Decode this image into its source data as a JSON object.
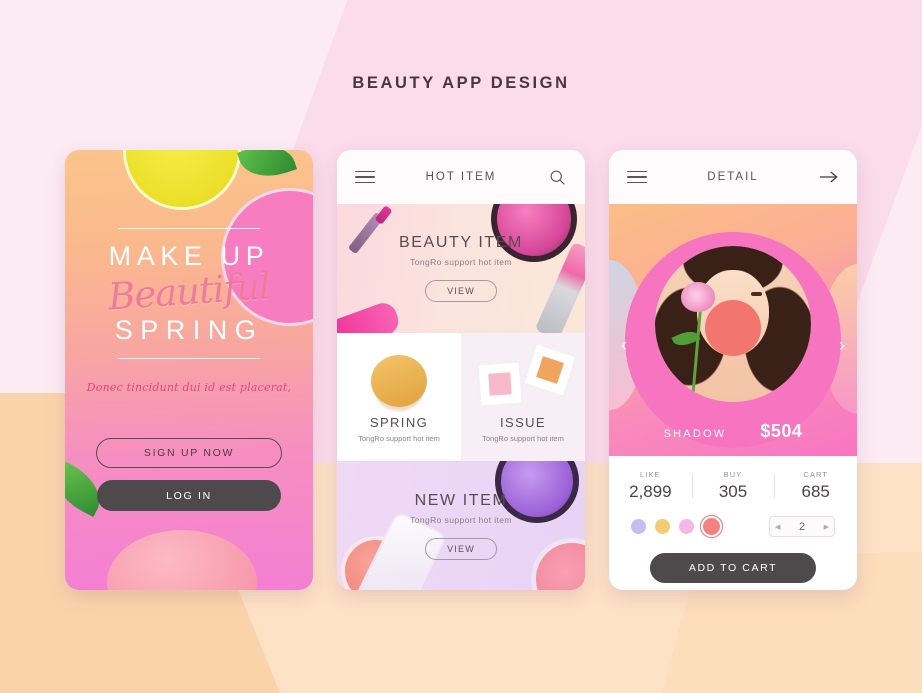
{
  "page": {
    "title": "BEAUTY APP DESIGN",
    "background_color": "#fcebf3",
    "accent_pink": "#f775c0",
    "accent_peach": "#fbbe86",
    "dark_button": "#4e4a4b"
  },
  "screen1": {
    "name": "intro-screen",
    "headline": "MAKE UP",
    "script_word": "Beautiful",
    "subheadline": "SPRING",
    "tagline": "Donec tincidunt dui id est placerat,",
    "signup_label": "SIGN UP NOW",
    "login_label": "LOG IN",
    "decor": [
      "lemon-half",
      "green-leaf",
      "pink-blush-compact",
      "powder-puff"
    ]
  },
  "screen2": {
    "name": "hot-item-screen",
    "header": {
      "menu_icon": "hamburger-menu-icon",
      "title": "HOT ITEM",
      "search_icon": "search-icon"
    },
    "sections": [
      {
        "title": "BEAUTY ITEM",
        "subtitle": "TongRo support hot item",
        "button": "VIEW",
        "background": "#fbdfdc"
      },
      {
        "title": "NEW ITEM",
        "subtitle": "TongRo support hot item",
        "button": "VIEW",
        "background": "#ead6f4"
      }
    ],
    "cards": [
      {
        "title": "SPRING",
        "subtitle": "TongRo support hot item",
        "background": "#ffffff"
      },
      {
        "title": "ISSUE",
        "subtitle": "TongRo support hot item",
        "background": "#f8eef6"
      }
    ]
  },
  "screen3": {
    "name": "detail-screen",
    "header": {
      "menu_icon": "hamburger-menu-icon",
      "title": "DETAIL",
      "forward_icon": "arrow-right-icon"
    },
    "carousel": {
      "prev_icon": "chevron-left-icon",
      "next_icon": "chevron-right-icon"
    },
    "product": {
      "name": "SHADOW",
      "price": "$504"
    },
    "stats": [
      {
        "label": "LIKE",
        "value": "2,899"
      },
      {
        "label": "BUY",
        "value": "305"
      },
      {
        "label": "CART",
        "value": "685"
      }
    ],
    "swatches": [
      {
        "name": "lavender",
        "color": "#c3bdf0",
        "selected": false
      },
      {
        "name": "gold",
        "color": "#f3cb73",
        "selected": false
      },
      {
        "name": "pink",
        "color": "#f6b6e8",
        "selected": false
      },
      {
        "name": "coral",
        "color": "#f3827e",
        "selected": true
      }
    ],
    "quantity": {
      "decrement_icon": "triangle-left-icon",
      "value": "2",
      "increment_icon": "triangle-right-icon"
    },
    "add_to_cart_label": "ADD TO CART"
  }
}
